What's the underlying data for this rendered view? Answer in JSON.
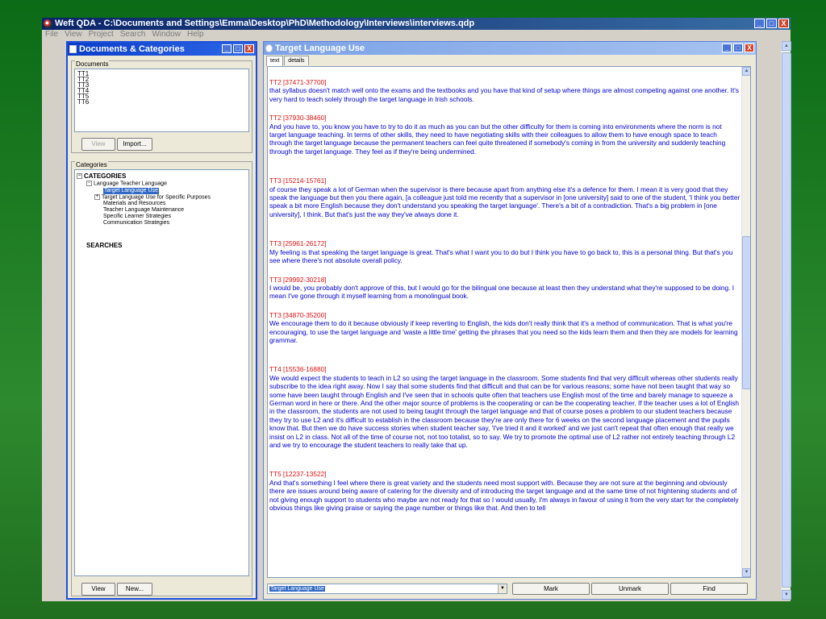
{
  "app": {
    "title": "Weft QDA - C:\\Documents and Settings\\Emma\\Desktop\\PhD\\Methodology\\Interviews\\interviews.qdp",
    "menu": [
      "File",
      "View",
      "Project",
      "Search",
      "Window",
      "Help"
    ],
    "minimize": "_",
    "maximize": "□",
    "close": "X"
  },
  "left_window": {
    "title": "Documents & Categories",
    "documents_label": "Documents",
    "documents": [
      "TT1",
      "TT2",
      "TT3",
      "TT4",
      "TT5",
      "TT6"
    ],
    "view_button": "View",
    "import_button": "Import...",
    "categories_label": "Categories",
    "tree": {
      "root": "CATEGORIES",
      "parent": "Language Teacher Language",
      "selected": "Target Language Use",
      "specific": "Target Language Use for Specific Purposes",
      "materials": "Materials and Resources",
      "maintenance": "Teacher Language Maintenance",
      "strategies": "Specific Learner Strategies",
      "communication": "Communication Strategies",
      "searches": "SEARCHES"
    },
    "bottom_view_button": "View",
    "new_button": "New..."
  },
  "right_window": {
    "title": "Target Language Use",
    "tabs": [
      "text",
      "details"
    ],
    "segments": [
      {
        "ref": "TT2 [37471-37700]",
        "text": "that syllabus doesn't match well onto the exams and the textbooks and you have that kind of setup where things are almost competing against one another. It's very hard to teach solely through the target language in Irish schools."
      },
      {
        "ref": "TT2 [37930-38460]",
        "text": "And you have to, you know you have to try to do it as much as you can but the other difficulty for them is coming into environments where the norm is not target language teaching. In terms of other skills, they need to have negotiating skills with their colleagues to allow them to have enough space to teach through the target language because the permanent teachers can feel quite threatened if somebody's coming in from the university and suddenly teaching through the target language. They feel as if they're being undermined."
      },
      {
        "ref": "TT3 [15214-15761]",
        "text": "of course they speak a lot of German when the supervisor is there because apart from anything else it's a defence for them. I mean it is very good that they speak the language but then you there again, [a colleague just told me recently that a supervisor in [one university] said to one of the student, 'I think you better speak a bit more English because they don't understand you speaking the target language'. There's a bit of a contradiction. That's a big problem in [one university], I think. But that's just the way they've always done it."
      },
      {
        "ref": "TT3 [25961-26172]",
        "text": "My feeling is that speaking the target language is great. That's what I want you to do but I think you have to go back to, this is a personal thing. But that's you see where there's not absolute overall policy."
      },
      {
        "ref": "TT3 [29992-30218]",
        "text": "I would be, you probably don't approve of this, but I would go for the bilingual one because at least then they understand what they're supposed to be doing. I mean I've gone through it myself learning from a monolingual book."
      },
      {
        "ref": "TT3 [34870-35200]",
        "text": "We encourage them to do it because obviously if keep reverting to English, the kids don't really think that it's a method of communication. That is what you're encouraging, to use the target language and 'waste a little time' getting the phrases that you need so the kids learn them and then they are models for learning grammar."
      },
      {
        "ref": "TT4 [15536-16880]",
        "text": " We would expect the students to teach in L2 so using the target language in the classroom. Some students find that very difficult whereas other students really subscribe to the idea right away. Now I say that some students find that difficult and that can be for various reasons; some have not been taught that way so some have been taught through English and I've seen that in schools quite often that teachers use English most of the time and barely manage to squeeze a German word in here or there. And the other major source of problems is the cooperating or can be the cooperating teacher. If the teacher uses a lot of English in the classroom, the students are not used to being taught through the target language and that of course poses a problem to our student teachers because they try to use L2 and it's difficult to establish in the classroom because they're are only there for 6 weeks on the second language placement and the pupils know that. But then we do have success stories when student teacher say, 'I've tried it and it worked' and we just can't repeat that often enough that really we insist on L2 in class. Not all of the time of course not, not too totalist, so to say. We try to promote the optimal use of L2 rather not entirely teaching through L2 and we try to encourage the student teachers to really take that up."
      },
      {
        "ref": "TT5 [12237-13522]",
        "text": " And that's something I feel where there is great variety and the students need most support with. Because they are not sure at the beginning and obviously there are issues around being aware of catering for the diversity and of introducing the target language and at the same time of not frightening students and of not giving enough support to students who maybe are not ready for that so I would usually, I'm always in favour of using it from the very start for the completely obvious things like giving praise or saying the page number or things like that. And then to tell"
      }
    ],
    "category_select": "Target Language Use",
    "mark_button": "Mark",
    "unmark_button": "Unmark",
    "find_button": "Find"
  }
}
